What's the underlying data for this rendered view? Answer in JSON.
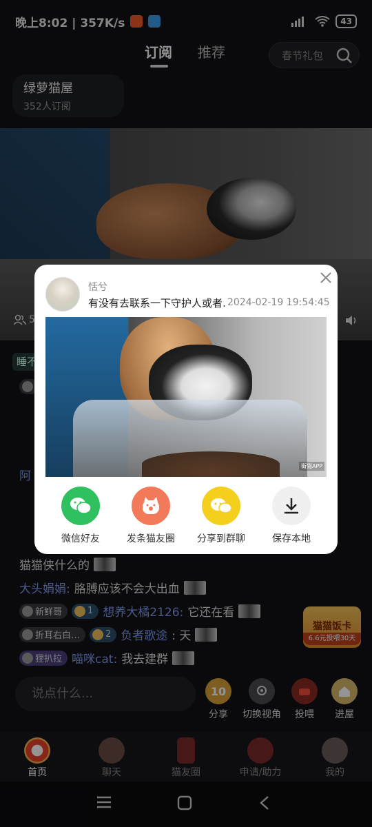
{
  "status_bar": {
    "time_speed": "晚上8:02 | 357K/s",
    "battery": "43",
    "colors": {
      "app1": "#f05a2a",
      "app2": "#3c9be8"
    }
  },
  "top_nav": {
    "tabs": [
      {
        "label": "订阅"
      },
      {
        "label": "推荐"
      }
    ],
    "search_placeholder": "春节礼包"
  },
  "room": {
    "name": "绿萝猫屋",
    "subscribers": "352人订阅"
  },
  "video": {
    "viewer_count": "5"
  },
  "chat": {
    "tag_top": "睡不",
    "partial_name": "阿",
    "lines": [
      {
        "username": "",
        "message": "猫猫侠什么的"
      },
      {
        "username": "大头娟娟:",
        "message": " 胳膊应该不会大出血"
      },
      {
        "badges": [
          "新鲜哥",
          "1"
        ],
        "username": "想养大橘2126:",
        "message": " 它还在看"
      },
      {
        "badges": [
          "折耳右白…",
          "2"
        ],
        "username": "负者歌途",
        "message": ": 天"
      },
      {
        "badges": [
          "狸扒拉",
          "1"
        ],
        "username": "喵咪cat:",
        "message": " 我去建群"
      }
    ]
  },
  "promo": {
    "title": "猫猫饭卡",
    "subtitle": "6.6元投喂30天"
  },
  "input": {
    "placeholder": "说点什么..."
  },
  "actions": [
    {
      "label": "分享",
      "icon": "coin-10-icon",
      "badge": "10"
    },
    {
      "label": "切换视角",
      "icon": "camera-icon"
    },
    {
      "label": "投喂",
      "icon": "feed-bowl-icon"
    },
    {
      "label": "进屋",
      "icon": "house-icon"
    }
  ],
  "bottom_nav": [
    {
      "label": "首页",
      "active": true
    },
    {
      "label": "聊天"
    },
    {
      "label": "猫友圈"
    },
    {
      "label": "申请/助力"
    },
    {
      "label": "我的"
    }
  ],
  "dialog": {
    "poster_name": "恬兮",
    "description": "有没有去联系一下守护人或者…",
    "timestamp": "2024-02-19 19:54:45",
    "watermark": "街猫APP",
    "share_options": [
      {
        "label": "微信好友",
        "icon": "wechat-icon",
        "color": "#2fc060"
      },
      {
        "label": "发条猫友圈",
        "icon": "cat-paw-icon",
        "color": "#f2795a"
      },
      {
        "label": "分享到群聊",
        "icon": "group-chat-icon",
        "color": "#f4cf1e"
      },
      {
        "label": "保存本地",
        "icon": "download-icon",
        "color": "#f0f0f0"
      }
    ]
  }
}
